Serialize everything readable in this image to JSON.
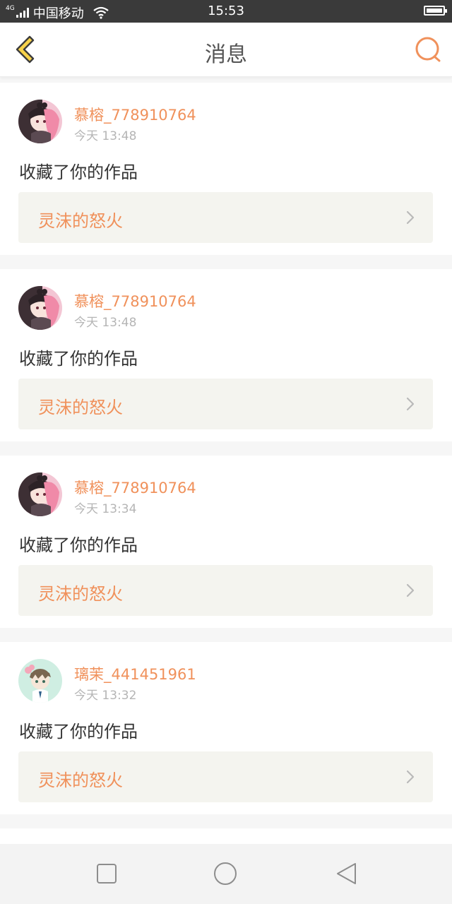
{
  "status_bar": {
    "network": "4G",
    "carrier": "中国移动",
    "time": "15:53"
  },
  "header": {
    "title": "消息"
  },
  "colors": {
    "accent": "#f0915b",
    "back_icon_fill": "#f7d24a",
    "card_bg": "#f4f4ef"
  },
  "messages": [
    {
      "username": "慕榕_778910764",
      "time": "今天 13:48",
      "action": "收藏了你的作品",
      "work_title": "灵沫的怒火",
      "avatar_icon": "avatar-pink-hair-girl"
    },
    {
      "username": "慕榕_778910764",
      "time": "今天 13:48",
      "action": "收藏了你的作品",
      "work_title": "灵沫的怒火",
      "avatar_icon": "avatar-pink-hair-girl"
    },
    {
      "username": "慕榕_778910764",
      "time": "今天 13:34",
      "action": "收藏了你的作品",
      "work_title": "灵沫的怒火",
      "avatar_icon": "avatar-pink-hair-girl"
    },
    {
      "username": "璃茉_441451961",
      "time": "今天 13:32",
      "action": "收藏了你的作品",
      "work_title": "灵沫的怒火",
      "avatar_icon": "avatar-green-anime-boy"
    }
  ],
  "nav_bar": {
    "buttons": [
      "recent-apps-icon",
      "home-icon",
      "back-triangle-icon"
    ]
  }
}
